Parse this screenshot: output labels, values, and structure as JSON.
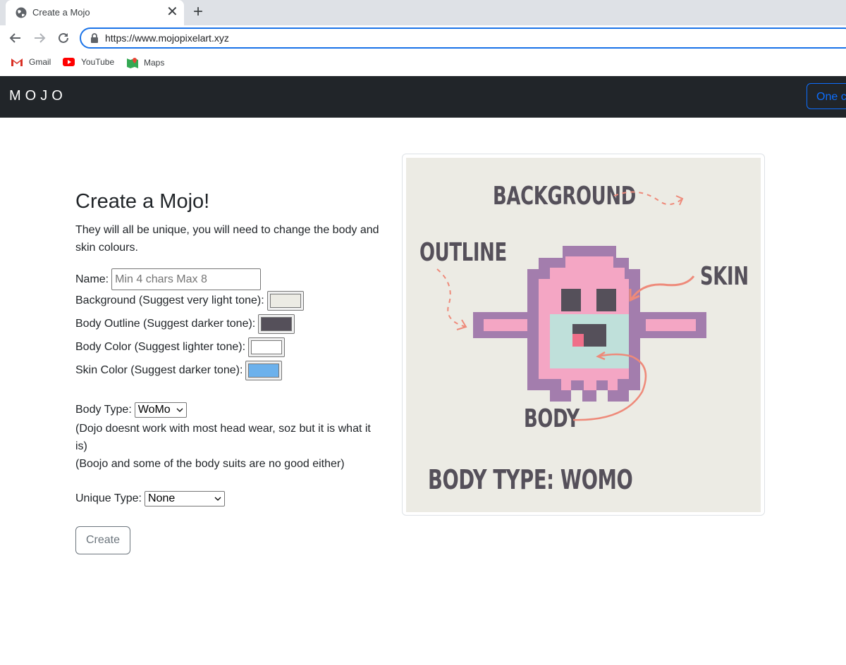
{
  "browser": {
    "tab_title": "Create a Mojo",
    "url": "https://www.mojopixelart.xyz",
    "bookmarks": [
      "Gmail",
      "YouTube",
      "Maps"
    ]
  },
  "navbar": {
    "brand": "MOJO",
    "button_label": "One c"
  },
  "form": {
    "heading": "Create a Mojo!",
    "intro": "They will all be unique, you will need to change the body and skin colours.",
    "name_label": "Name:",
    "name_placeholder": "Min 4 chars Max 8",
    "background_label": "Background (Suggest very light tone):",
    "outline_label": "Body Outline (Suggest darker tone):",
    "body_color_label": "Body Color (Suggest lighter tone):",
    "skin_color_label": "Skin Color (Suggest darker tone):",
    "body_type_label": "Body Type:",
    "body_type_value": "WoMo",
    "note1": "(Dojo doesnt work with most head wear, soz but it is what it is)",
    "note2": "(Boojo and some of the body suits are no good either)",
    "unique_type_label": "Unique Type:",
    "unique_type_value": "None",
    "create_label": "Create"
  },
  "swatches": {
    "background": "#ecebe4",
    "outline": "#55505a",
    "body": "#ffffff",
    "skin": "#6cb1ec"
  },
  "preview": {
    "labels": {
      "background": "BACKGROUND",
      "outline": "OUTLINE",
      "skin": "SKIN",
      "body": "BODY",
      "body_type": "BODY TYPE: WOMO"
    }
  }
}
